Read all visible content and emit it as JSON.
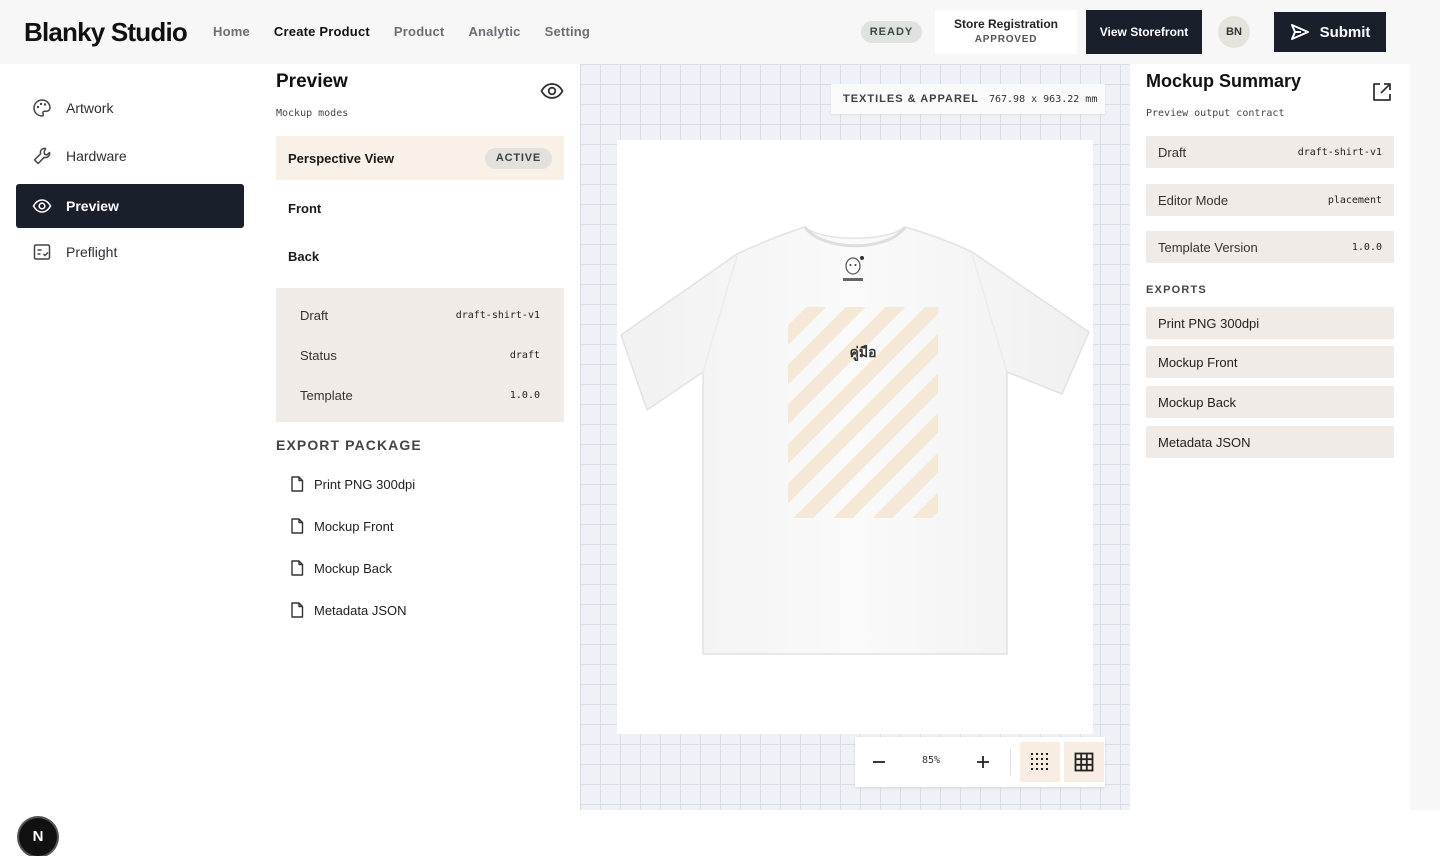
{
  "header": {
    "brand": "Blanky Studio",
    "nav": [
      "Home",
      "Create Product",
      "Product",
      "Analytic",
      "Setting"
    ],
    "nav_active": "Create Product",
    "status_badge": "READY",
    "store_registration": {
      "title": "Store Registration",
      "status": "APPROVED"
    },
    "view_storefront": "View Storefront",
    "avatar_initials": "BN",
    "submit_label": "Submit"
  },
  "sidebar": {
    "items": [
      {
        "label": "Artwork",
        "icon": "palette-icon"
      },
      {
        "label": "Hardware",
        "icon": "wrench-icon"
      },
      {
        "label": "Preview",
        "icon": "eye-icon",
        "active": true
      },
      {
        "label": "Preflight",
        "icon": "checklist-icon"
      }
    ],
    "footer_logo": "N"
  },
  "preview": {
    "title": "Preview",
    "subtitle": "Mockup modes",
    "modes": [
      {
        "label": "Perspective View",
        "badge": "ACTIVE"
      },
      {
        "label": "Front"
      },
      {
        "label": "Back"
      }
    ],
    "info": [
      {
        "label": "Draft",
        "value": "draft-shirt-v1"
      },
      {
        "label": "Status",
        "value": "draft"
      },
      {
        "label": "Template",
        "value": "1.0.0"
      }
    ],
    "export_heading": "EXPORT PACKAGE",
    "exports": [
      "Print PNG 300dpi",
      "Mockup Front",
      "Mockup Back",
      "Metadata JSON"
    ]
  },
  "canvas": {
    "category": "TEXTILES & APPAREL",
    "dimensions": "767.98 x 963.22 mm",
    "artwork_text": "คู่มือ",
    "zoom": "85%",
    "colors": {
      "grid": "#d6dde6",
      "stripe": "#f3e3cf"
    }
  },
  "summary": {
    "title": "Mockup Summary",
    "subtitle": "Preview output contract",
    "rows": [
      {
        "label": "Draft",
        "value": "draft-shirt-v1"
      },
      {
        "label": "Editor Mode",
        "value": "placement"
      },
      {
        "label": "Template Version",
        "value": "1.0.0"
      }
    ],
    "exports_heading": "EXPORTS",
    "exports": [
      "Print PNG 300dpi",
      "Mockup Front",
      "Mockup Back",
      "Metadata JSON"
    ]
  }
}
